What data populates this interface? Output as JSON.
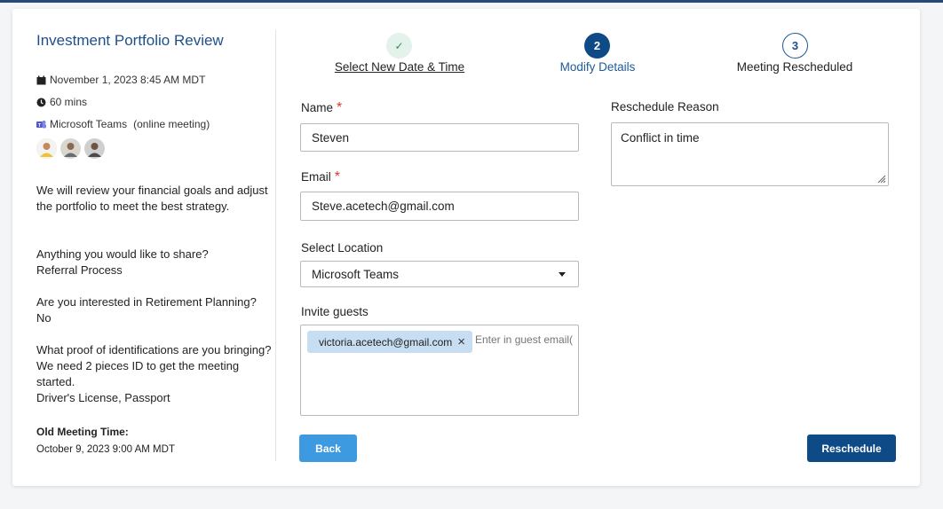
{
  "event": {
    "title": "Investment Portfolio Review",
    "date": "November 1, 2023 8:45 AM MDT",
    "duration": "60 mins",
    "location": "Microsoft Teams",
    "location_note": "(online meeting)",
    "description": "We will review your financial goals and adjust the portfolio to meet the best strategy.",
    "qa": [
      {
        "question": "Anything you would like to share?",
        "answer": "Referral Process"
      },
      {
        "question": "Are you interested in Retirement Planning?",
        "answer": "No"
      },
      {
        "question": "What proof of identifications are you bringing? We need 2 pieces ID to get the meeting started.",
        "answer": "Driver's License, Passport"
      }
    ],
    "old_time_label": "Old Meeting Time:",
    "old_time_value": "October 9, 2023 9:00 AM MDT"
  },
  "steps": [
    {
      "number": "✓",
      "label": "Select New Date & Time",
      "state": "done"
    },
    {
      "number": "2",
      "label": "Modify Details",
      "state": "active"
    },
    {
      "number": "3",
      "label": "Meeting Rescheduled",
      "state": "pending"
    }
  ],
  "form": {
    "name_label": "Name",
    "name_value": "Steven",
    "email_label": "Email",
    "email_value": "Steve.acetech@gmail.com",
    "required_mark": "*",
    "location_label": "Select Location",
    "location_value": "Microsoft Teams",
    "guests_label": "Invite guests",
    "guest_chip": "victoria.acetech@gmail.com",
    "guest_chip_remove": "×",
    "guest_placeholder": "Enter in guest email(",
    "reason_label": "Reschedule Reason",
    "reason_value": "Conflict in time"
  },
  "buttons": {
    "back": "Back",
    "reschedule": "Reschedule"
  },
  "colors": {
    "primary": "#0d4a86",
    "back_button": "#3d9ae0",
    "title": "#1d4f8a",
    "chip": "#c7def2",
    "required": "#d9382e"
  }
}
